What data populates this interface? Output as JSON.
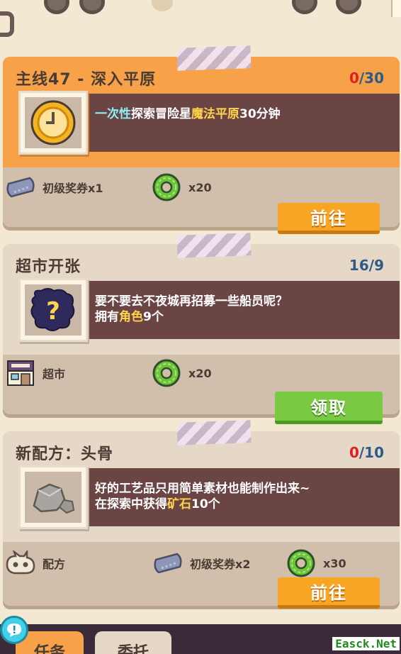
{
  "quests": [
    {
      "title": "主线47 - 深入平原",
      "progress_current": "0",
      "progress_total": "/30",
      "desc_parts": [
        "一次性",
        "探索冒险星",
        "魔法平原",
        "30分钟"
      ],
      "rewards": [
        {
          "label": "初级奖券x1",
          "icon": "ticket-icon"
        },
        {
          "label": "x20",
          "icon": "green-donut-coin-icon"
        }
      ],
      "button": "前往",
      "icon": "clock-coin-icon"
    },
    {
      "title": "超市开张",
      "progress_current": "16",
      "progress_total": "/9",
      "desc_line1": "要不要去不夜城再招募一些船员呢？",
      "desc_line2_parts": [
        "拥有",
        "角色",
        "9个"
      ],
      "rewards": [
        {
          "label": "超市",
          "icon": "supermarket-icon"
        },
        {
          "label": "x20",
          "icon": "green-donut-coin-icon"
        }
      ],
      "button": "领取",
      "icon": "mystery-question-icon"
    },
    {
      "title": "新配方：头骨",
      "progress_current": "0",
      "progress_total": "/10",
      "desc_line1": "好的工艺品只用简单素材也能制作出来~",
      "desc_line2_parts": [
        "在探索中获得",
        "矿石",
        "10个"
      ],
      "rewards": [
        {
          "label": "配方",
          "icon": "skull-recipe-icon"
        },
        {
          "label": "初级奖券x2",
          "icon": "ticket-icon"
        },
        {
          "label": "x30",
          "icon": "green-donut-coin-icon"
        }
      ],
      "button": "前往",
      "icon": "ore-rock-icon"
    }
  ],
  "tabs": [
    "任务",
    "委托"
  ],
  "watermark": "Easck.Net",
  "colors": {
    "accent_orange": "#f7a248",
    "desc_bg": "#6b4444",
    "highlight_yellow": "#ffd34d",
    "highlight_cyan": "#8ff0f0",
    "progress_red": "#e02020",
    "progress_blue": "#2d5a88",
    "claim_green": "#7ac943",
    "go_orange": "#f7a623"
  }
}
